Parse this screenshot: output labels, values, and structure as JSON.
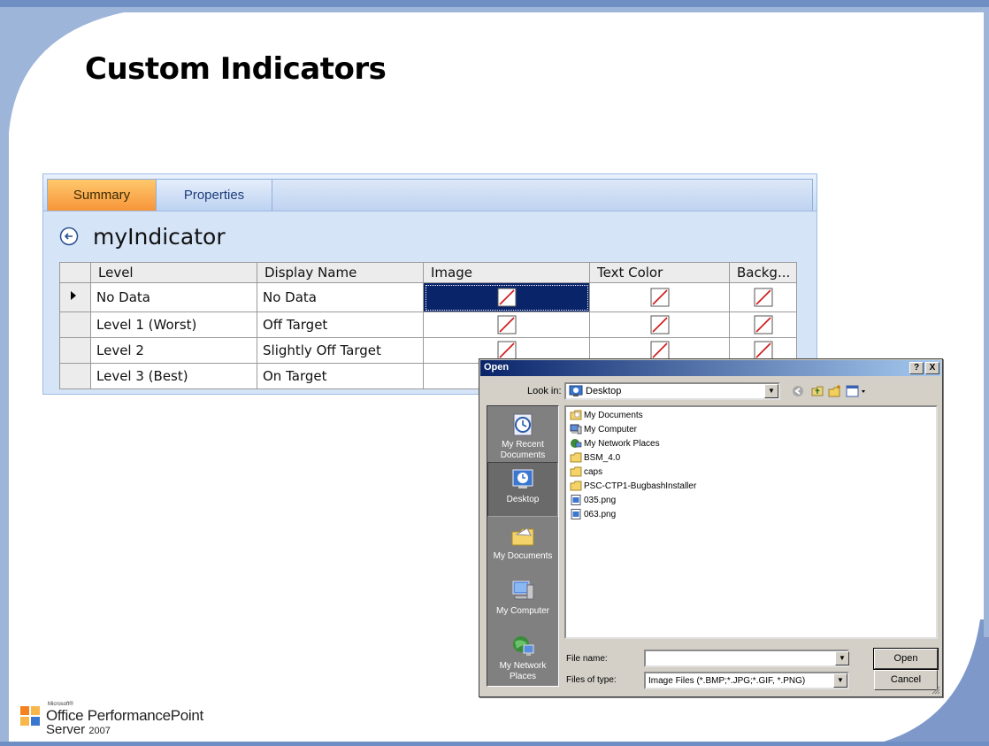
{
  "slide": {
    "title": "Custom Indicators",
    "colors": {
      "frame_blue": "#5b7bb3",
      "frame_light": "#9eb5da"
    }
  },
  "panel": {
    "tabs": [
      {
        "label": "Summary",
        "active": true
      },
      {
        "label": "Properties",
        "active": false
      }
    ],
    "indicator_name": "myIndicator",
    "back_icon": "back-arrow-icon",
    "grid": {
      "columns": [
        "Level",
        "Display Name",
        "Image",
        "Text Color",
        "Backg..."
      ],
      "rows": [
        {
          "level": "No Data",
          "display_name": "No Data",
          "current": true
        },
        {
          "level": "Level 1 (Worst)",
          "display_name": "Off Target",
          "current": false
        },
        {
          "level": "Level 2",
          "display_name": "Slightly Off Target",
          "current": false
        },
        {
          "level": "Level 3 (Best)",
          "display_name": "On Target",
          "current": false
        }
      ]
    }
  },
  "dialog": {
    "title": "Open",
    "help_button": "?",
    "close_button": "X",
    "look_in_label": "Look in:",
    "look_in_value": "Desktop",
    "places": [
      "My Recent Documents",
      "Desktop",
      "My Documents",
      "My Computer",
      "My Network Places"
    ],
    "files": [
      {
        "name": "My Documents",
        "icon": "folder-docs-icon"
      },
      {
        "name": "My Computer",
        "icon": "computer-icon"
      },
      {
        "name": "My Network Places",
        "icon": "network-icon"
      },
      {
        "name": "BSM_4.0",
        "icon": "folder-icon"
      },
      {
        "name": "caps",
        "icon": "folder-icon"
      },
      {
        "name": "PSC-CTP1-BugbashInstaller",
        "icon": "folder-icon"
      },
      {
        "name": "035.png",
        "icon": "image-file-icon"
      },
      {
        "name": "063.png",
        "icon": "image-file-icon"
      }
    ],
    "file_name_label": "File name:",
    "file_name_value": "",
    "files_of_type_label": "Files of type:",
    "files_of_type_value": "Image Files (*.BMP;*.JPG;*.GIF, *.PNG)",
    "open_button": "Open",
    "cancel_button": "Cancel"
  },
  "logo": {
    "microsoft": "Microsoft®",
    "line1": "Office PerformancePoint",
    "line2": "Server",
    "year": "2007"
  }
}
